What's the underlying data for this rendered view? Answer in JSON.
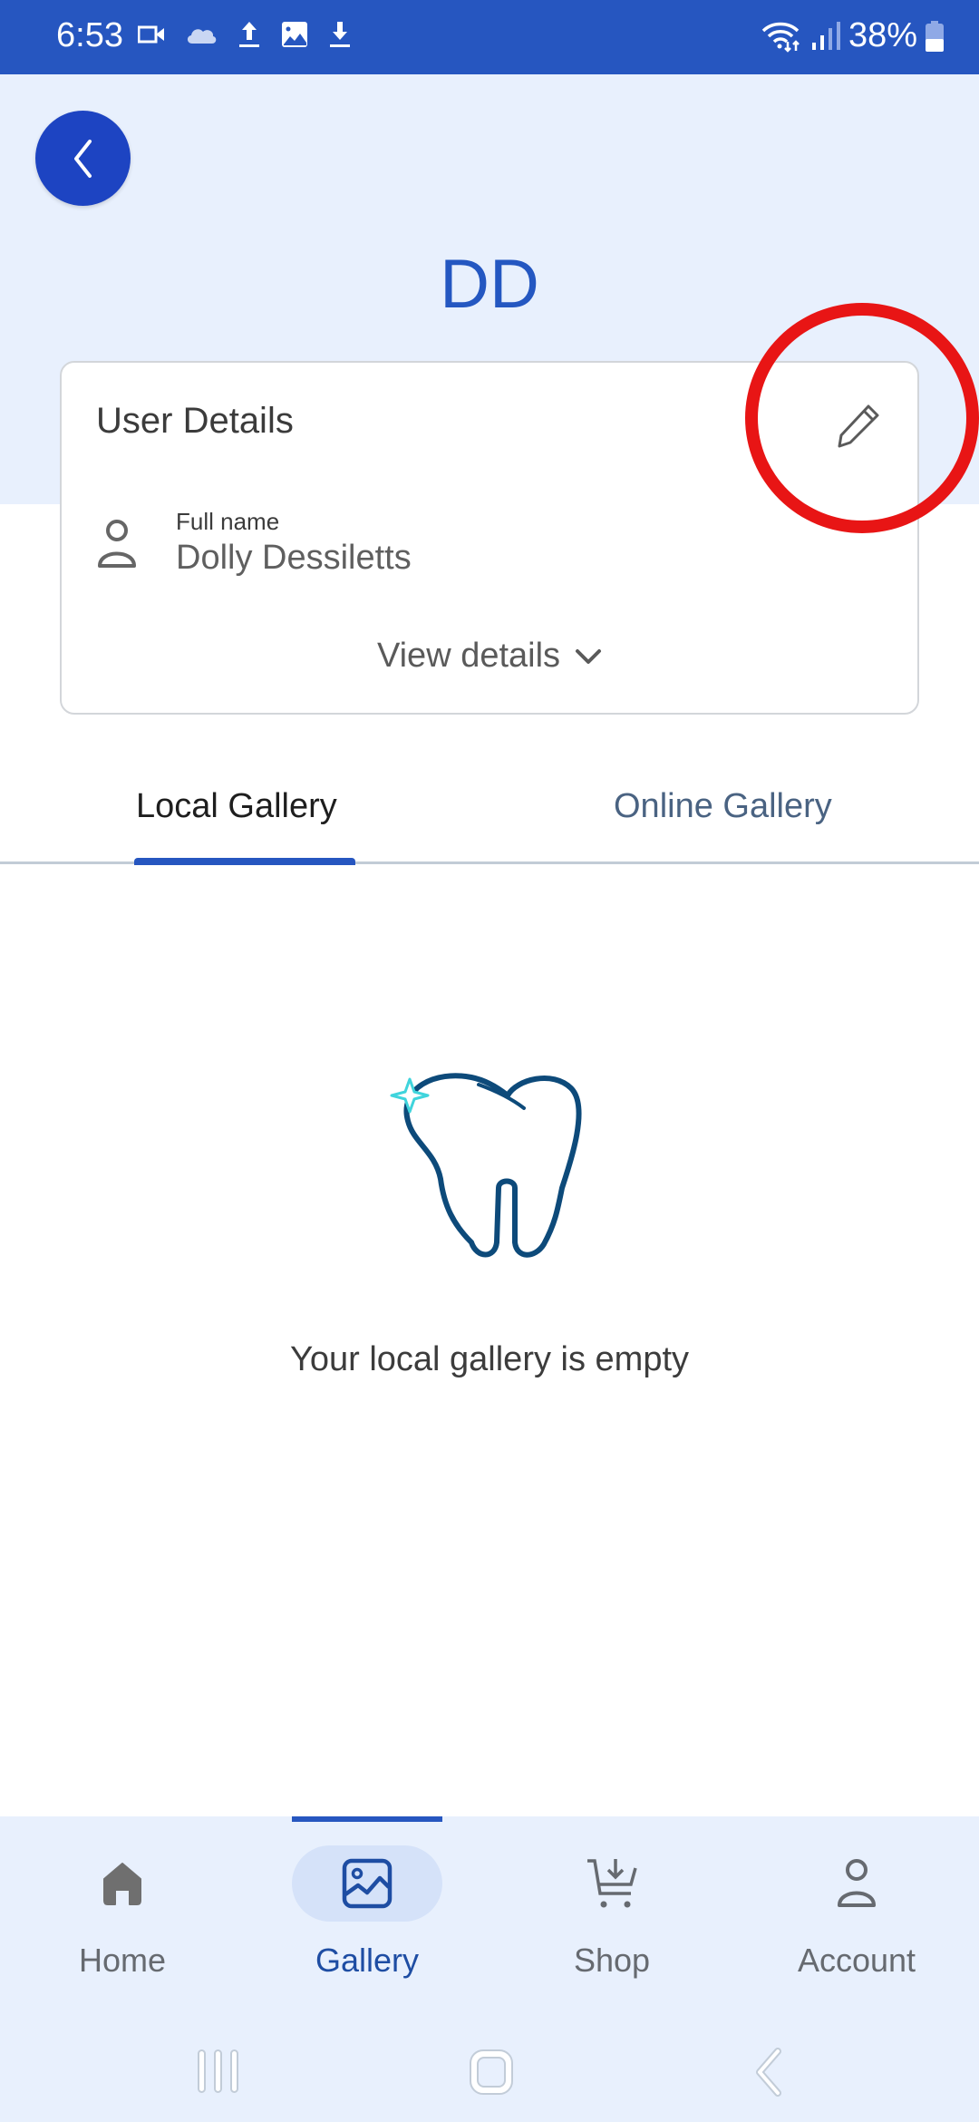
{
  "status_bar": {
    "time": "6:53",
    "left_icons": [
      "video-icon",
      "cloud-icon",
      "upload-icon",
      "image-icon",
      "download-icon"
    ],
    "battery_percent": "38%",
    "right_icons": [
      "wifi-icon",
      "signal-icon",
      "battery-icon"
    ]
  },
  "header": {
    "back_icon": "chevron-left-icon",
    "initials": "DD"
  },
  "user_details": {
    "title": "User Details",
    "edit_icon": "pencil-icon",
    "field_label": "Full name",
    "field_value": "Dolly Dessiletts",
    "view_details_label": "View details"
  },
  "annotation": {
    "highlight_color": "#e81515"
  },
  "tabs": [
    {
      "label": "Local Gallery",
      "active": true
    },
    {
      "label": "Online Gallery",
      "active": false
    }
  ],
  "gallery": {
    "empty_message": "Your local gallery is empty",
    "illustration": "tooth-icon"
  },
  "bottom_nav": {
    "items": [
      {
        "label": "Home",
        "icon": "home-icon",
        "active": false
      },
      {
        "label": "Gallery",
        "icon": "gallery-icon",
        "active": true
      },
      {
        "label": "Shop",
        "icon": "cart-icon",
        "active": false
      },
      {
        "label": "Account",
        "icon": "account-icon",
        "active": false
      }
    ]
  },
  "system_nav": [
    "recents-button",
    "home-button",
    "back-button"
  ],
  "colors": {
    "primary": "#2656c0",
    "header_bg": "#e8f0fd",
    "active_tab_text": "#1e1e1e",
    "inactive_tab_text": "#4a6382",
    "tooth_stroke": "#0d4a7a",
    "sparkle": "#3fd4dc"
  }
}
